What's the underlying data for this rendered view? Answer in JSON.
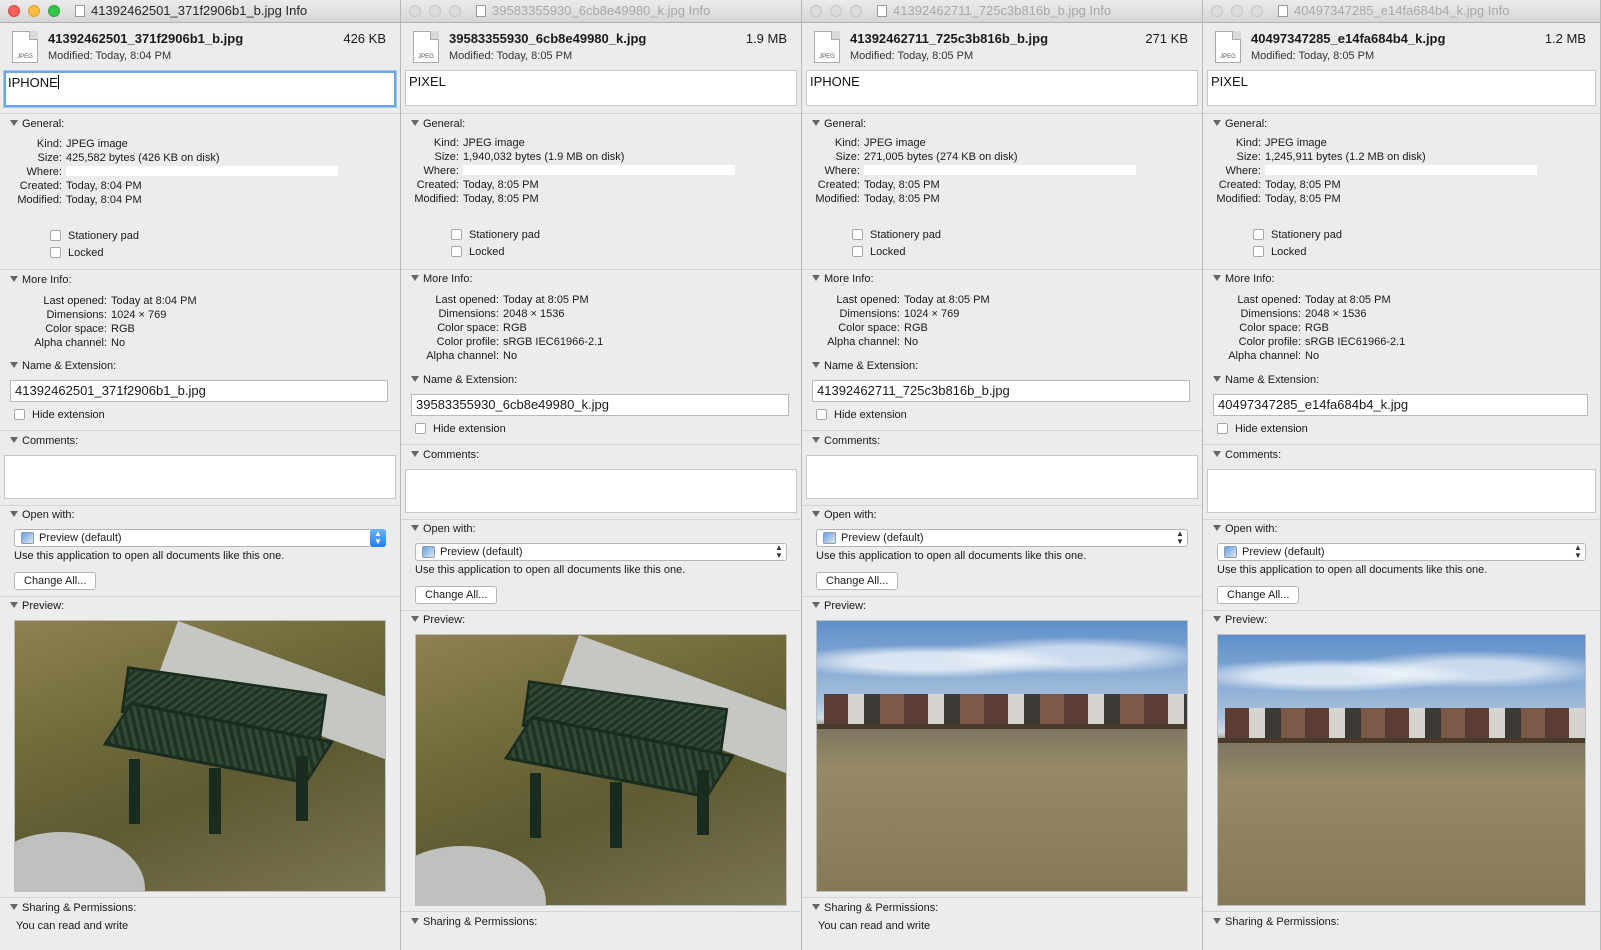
{
  "windows": [
    {
      "title": "41392462501_371f2906b1_b.jpg Info",
      "active": true,
      "file_name": "41392462501_371f2906b1_b.jpg",
      "file_size": "426 KB",
      "modified": "Modified: Today, 8:04 PM",
      "tags": "IPHONE",
      "general_label": "General:",
      "general": [
        {
          "k": "Kind:",
          "v": "JPEG image"
        },
        {
          "k": "Size:",
          "v": "425,582 bytes (426 KB on disk)"
        },
        {
          "k": "Where:",
          "v": ""
        },
        {
          "k": "Created:",
          "v": "Today, 8:04 PM"
        },
        {
          "k": "Modified:",
          "v": "Today, 8:04 PM"
        }
      ],
      "stationery_label": "Stationery pad",
      "locked_label": "Locked",
      "moreinfo_label": "More Info:",
      "moreinfo": [
        {
          "k": "Last opened:",
          "v": "Today at 8:04 PM"
        },
        {
          "k": "Dimensions:",
          "v": "1024 × 769"
        },
        {
          "k": "Color space:",
          "v": "RGB"
        },
        {
          "k": "Alpha channel:",
          "v": "No"
        }
      ],
      "name_ext_label": "Name & Extension:",
      "name_ext_value": "41392462501_371f2906b1_b.jpg",
      "hide_ext_label": "Hide extension",
      "comments_label": "Comments:",
      "open_with_label": "Open with:",
      "open_with_value": "Preview (default)",
      "use_app_text": "Use this application to open all documents like this one.",
      "change_all_label": "Change All...",
      "preview_label": "Preview:",
      "preview_kind": "bench",
      "sharing_label": "Sharing & Permissions:",
      "sharing_text": "You can read and write"
    },
    {
      "title": "39583355930_6cb8e49980_k.jpg Info",
      "active": false,
      "file_name": "39583355930_6cb8e49980_k.jpg",
      "file_size": "1.9 MB",
      "modified": "Modified: Today, 8:05 PM",
      "tags": "PIXEL",
      "general_label": "General:",
      "general": [
        {
          "k": "Kind:",
          "v": "JPEG image"
        },
        {
          "k": "Size:",
          "v": "1,940,032 bytes (1.9 MB on disk)"
        },
        {
          "k": "Where:",
          "v": ""
        },
        {
          "k": "Created:",
          "v": "Today, 8:05 PM"
        },
        {
          "k": "Modified:",
          "v": "Today, 8:05 PM"
        }
      ],
      "stationery_label": "Stationery pad",
      "locked_label": "Locked",
      "moreinfo_label": "More Info:",
      "moreinfo": [
        {
          "k": "Last opened:",
          "v": "Today at 8:05 PM"
        },
        {
          "k": "Dimensions:",
          "v": "2048 × 1536"
        },
        {
          "k": "Color space:",
          "v": "RGB"
        },
        {
          "k": "Color profile:",
          "v": "sRGB IEC61966-2.1"
        },
        {
          "k": "Alpha channel:",
          "v": "No"
        }
      ],
      "name_ext_label": "Name & Extension:",
      "name_ext_value": "39583355930_6cb8e49980_k.jpg",
      "hide_ext_label": "Hide extension",
      "comments_label": "Comments:",
      "open_with_label": "Open with:",
      "open_with_value": "Preview (default)",
      "use_app_text": "Use this application to open all documents like this one.",
      "change_all_label": "Change All...",
      "preview_label": "Preview:",
      "preview_kind": "bench",
      "sharing_label": "Sharing & Permissions:",
      "sharing_text": ""
    },
    {
      "title": "41392462711_725c3b816b_b.jpg Info",
      "active": false,
      "file_name": "41392462711_725c3b816b_b.jpg",
      "file_size": "271 KB",
      "modified": "Modified: Today, 8:05 PM",
      "tags": "IPHONE",
      "general_label": "General:",
      "general": [
        {
          "k": "Kind:",
          "v": "JPEG image"
        },
        {
          "k": "Size:",
          "v": "271,005 bytes (274 KB on disk)"
        },
        {
          "k": "Where:",
          "v": ""
        },
        {
          "k": "Created:",
          "v": "Today, 8:05 PM"
        },
        {
          "k": "Modified:",
          "v": "Today, 8:05 PM"
        }
      ],
      "stationery_label": "Stationery pad",
      "locked_label": "Locked",
      "moreinfo_label": "More Info:",
      "moreinfo": [
        {
          "k": "Last opened:",
          "v": "Today at 8:05 PM"
        },
        {
          "k": "Dimensions:",
          "v": "1024 × 769"
        },
        {
          "k": "Color space:",
          "v": "RGB"
        },
        {
          "k": "Alpha channel:",
          "v": "No"
        }
      ],
      "name_ext_label": "Name & Extension:",
      "name_ext_value": "41392462711_725c3b816b_b.jpg",
      "hide_ext_label": "Hide extension",
      "comments_label": "Comments:",
      "open_with_label": "Open with:",
      "open_with_value": "Preview (default)",
      "use_app_text": "Use this application to open all documents like this one.",
      "change_all_label": "Change All...",
      "preview_label": "Preview:",
      "preview_kind": "houses",
      "sharing_label": "Sharing & Permissions:",
      "sharing_text": "You can read and write"
    },
    {
      "title": "40497347285_e14fa684b4_k.jpg Info",
      "active": false,
      "file_name": "40497347285_e14fa684b4_k.jpg",
      "file_size": "1.2 MB",
      "modified": "Modified: Today, 8:05 PM",
      "tags": "PIXEL",
      "general_label": "General:",
      "general": [
        {
          "k": "Kind:",
          "v": "JPEG image"
        },
        {
          "k": "Size:",
          "v": "1,245,911 bytes (1.2 MB on disk)"
        },
        {
          "k": "Where:",
          "v": ""
        },
        {
          "k": "Created:",
          "v": "Today, 8:05 PM"
        },
        {
          "k": "Modified:",
          "v": "Today, 8:05 PM"
        }
      ],
      "stationery_label": "Stationery pad",
      "locked_label": "Locked",
      "moreinfo_label": "More Info:",
      "moreinfo": [
        {
          "k": "Last opened:",
          "v": "Today at 8:05 PM"
        },
        {
          "k": "Dimensions:",
          "v": "2048 × 1536"
        },
        {
          "k": "Color space:",
          "v": "RGB"
        },
        {
          "k": "Color profile:",
          "v": "sRGB IEC61966-2.1"
        },
        {
          "k": "Alpha channel:",
          "v": "No"
        }
      ],
      "name_ext_label": "Name & Extension:",
      "name_ext_value": "40497347285_e14fa684b4_k.jpg",
      "hide_ext_label": "Hide extension",
      "comments_label": "Comments:",
      "open_with_label": "Open with:",
      "open_with_value": "Preview (default)",
      "use_app_text": "Use this application to open all documents like this one.",
      "change_all_label": "Change All...",
      "preview_label": "Preview:",
      "preview_kind": "houses",
      "sharing_label": "Sharing & Permissions:",
      "sharing_text": ""
    }
  ]
}
